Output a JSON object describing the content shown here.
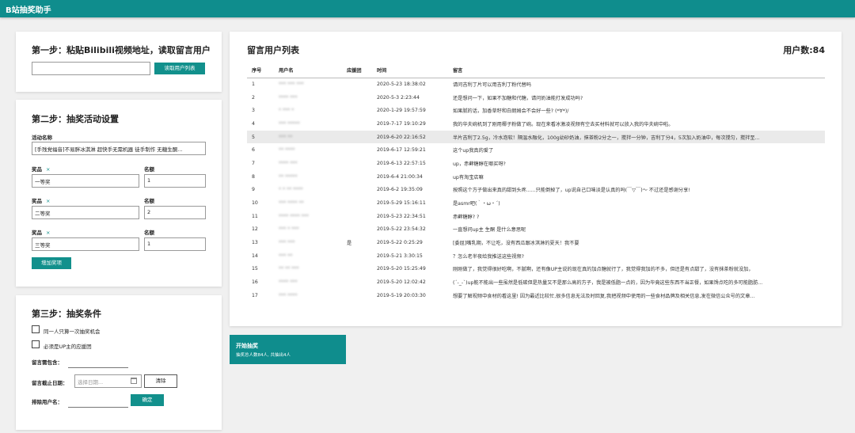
{
  "app": {
    "title": "B站抽奖助手"
  },
  "step1": {
    "title": "第一步：粘贴Bilibili视频地址，读取留言用户",
    "url_value": "",
    "read_button": "读取用户列表"
  },
  "step2": {
    "title": "第二步：抽奖活动设置",
    "activity_label": "活动名称",
    "activity_value": "[手残党福音]不易胖冰淇淋 超快手无需机器 徒手制作 无糖生酮...",
    "prize_label": "奖品",
    "quota_label": "名额",
    "remove_icon": "×",
    "prizes": [
      {
        "name": "一等奖",
        "count": "1"
      },
      {
        "name": "二等奖",
        "count": "2"
      },
      {
        "name": "三等奖",
        "count": "1"
      }
    ],
    "add_button": "增加奖项"
  },
  "step3": {
    "title": "第三步：抽奖条件",
    "once_only": "同一人只算一次抽奖机会",
    "must_support": "必须是UP主的应援团",
    "keyword_label": "留言需包含：",
    "keyword_value": "",
    "deadline_label": "留言截止日期：",
    "date_placeholder": "选择日期...",
    "calendar_icon": "calendar-icon",
    "clear_button": "清除",
    "exclude_label": "排除用户名：",
    "exclude_value": "",
    "confirm_button": "确定"
  },
  "list": {
    "title": "留言用户列表",
    "count_label": "用户数:84",
    "columns": [
      "序号",
      "用户名",
      "应援团",
      "时间",
      "留言"
    ],
    "rows": [
      {
        "no": "1",
        "user": "*** *** ***",
        "fan": "",
        "time": "2020-5-23 18:38:02",
        "msg": "请问吉利丁片可以用吉利丁粉代替吗"
      },
      {
        "no": "2",
        "user": "**** ***",
        "fan": "",
        "time": "2020-5-3 2:23:44",
        "msg": "还是想问一下，如果不加糖和代糖，请问奶油能打发成功吗?"
      },
      {
        "no": "3",
        "user": "* *** *",
        "fan": "",
        "time": "2020-1-29 19:57:59",
        "msg": "如果腻的话，加香草籽和白朗姆会不会好一些? (*∀*)/"
      },
      {
        "no": "4",
        "user": "*** *****",
        "fan": "",
        "time": "2019-7-17 19:10:29",
        "msg": "我的华夫碗机到了刚用椰子粉做了碗。现在来看冰激凌视频有空去买材料就可以放入我的华夫碗中啦。"
      },
      {
        "no": "5",
        "user": "*** **",
        "fan": "",
        "time": "2019-6-20 22:16:52",
        "msg": "半片吉利丁2.5g，冷水泡软！隔温水融化，100g幼砂奶油，抹茶粉2分之一，搅拌一分钟，吉利丁分4，5次加入奶油中，每次搅匀，搅拌至..."
      },
      {
        "no": "6",
        "user": "** ****",
        "fan": "",
        "time": "2019-6-17 12:59:21",
        "msg": "这个up我真的爱了"
      },
      {
        "no": "7",
        "user": "**** ***",
        "fan": "",
        "time": "2019-6-13 22:57:15",
        "msg": "up，赤藓糖醇在哪买呀?"
      },
      {
        "no": "8",
        "user": "** *****",
        "fan": "",
        "time": "2019-6-4 21:00:34",
        "msg": "up有淘宝店嘛"
      },
      {
        "no": "9",
        "user": "* * ** ****",
        "fan": "",
        "time": "2019-6-2 19:35:09",
        "msg": "按照这个方子做出来真的甜到头疼......只能倒掉了，up说自己口味淡是认真的吗(￣▽￣)～ 不过还是感谢分享!"
      },
      {
        "no": "10",
        "user": "*** **** **",
        "fan": "",
        "time": "2019-5-29 15:16:11",
        "msg": "是asmr吧(｀・ω・´)"
      },
      {
        "no": "11",
        "user": "**** **** ***",
        "fan": "",
        "time": "2019-5-23 22:34:51",
        "msg": "赤藓糖醇? ?"
      },
      {
        "no": "12",
        "user": "*** * ***",
        "fan": "",
        "time": "2019-5-22 23:54:32",
        "msg": "一直想问up主 生酮 是什么意思呢"
      },
      {
        "no": "13",
        "user": "*** ***",
        "fan": "是",
        "time": "2019-5-22 0:25:29",
        "msg": "[委屈]嘴乳期，不让吃，没有西瓜跟冰淇淋的夏天！我不要"
      },
      {
        "no": "14",
        "user": "*** **",
        "fan": "",
        "time": "2019-5-21 3:30:15",
        "msg": "？怎么老半夜给我推送这些视频?"
      },
      {
        "no": "15",
        "user": "** ** ***",
        "fan": "",
        "time": "2019-5-20 15:25:49",
        "msg": "刚刚做了，我觉得很好吃啊，不腻啊，还有像UP主说的现在真的加点糖就行了，我觉得我加的不多，但还是有点甜了，没有抹茶粉就没加，"
      },
      {
        "no": "16",
        "user": "**** ***",
        "fan": "",
        "time": "2019-5-20 12:02:42",
        "msg": "(´-_-`)up能不能出一些虽然是低碳但是热量又不是那么高的方子，我是被低脂一点的，因为毕竟这些东西不当正餐，如果馋点吃的多可能脂肪..."
      },
      {
        "no": "17",
        "user": "*** ****",
        "fan": "",
        "time": "2019-5-19 20:03:30",
        "msg": "想要了解视频中食材的看这里! 因为最近比较忙,很多信息无法及时回复,我把视频中使用的一些食材品牌及相关信息,发在微信公众号的文章..."
      }
    ]
  },
  "start": {
    "title": "开始抽奖",
    "subtitle": "抽奖总人数84人, 共抽出4人"
  }
}
